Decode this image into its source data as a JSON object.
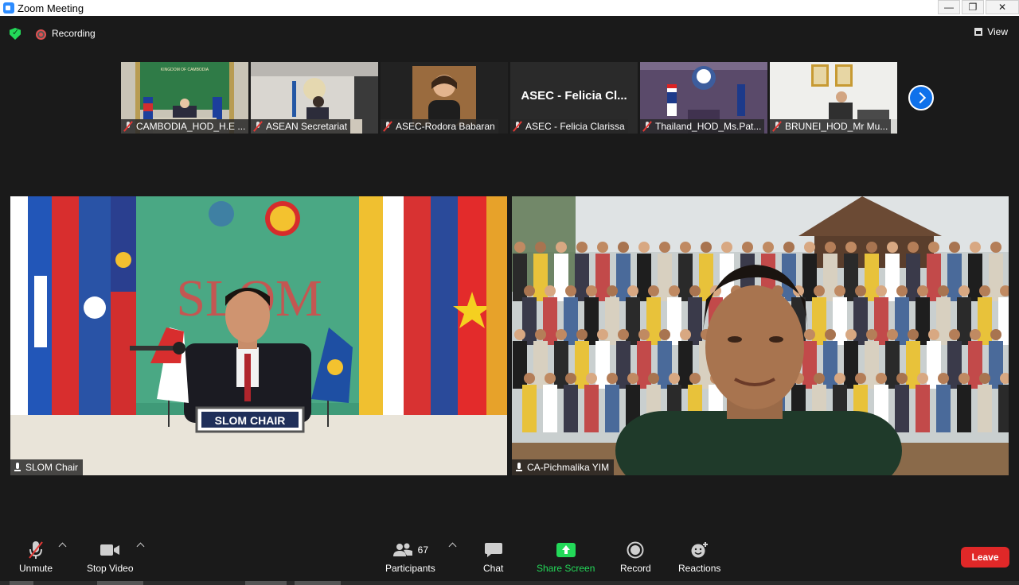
{
  "window": {
    "title": "Zoom Meeting",
    "controls": {
      "minimize": "—",
      "restore": "❐",
      "close": "✕"
    }
  },
  "top": {
    "recording_label": "Recording",
    "view_label": "View"
  },
  "thumbnails": [
    {
      "name": "CAMBODIA_HOD_H.E ...",
      "muted": true,
      "banner": "KINGDOM OF CAMBODIA"
    },
    {
      "name": "ASEAN Secretariat",
      "muted": true
    },
    {
      "name": "ASEC-Rodora Babaran",
      "muted": true
    },
    {
      "name": "ASEC - Felicia Clarissa",
      "muted": true,
      "display_text": "ASEC - Felicia Cl..."
    },
    {
      "name": "Thailand_HOD_Ms.Pat...",
      "muted": true
    },
    {
      "name": "BRUNEI_HOD_Mr Mu...",
      "muted": true
    }
  ],
  "videos": [
    {
      "name": "SLOM Chair",
      "backdrop_text": "SLOM",
      "placard": "SLOM CHAIR"
    },
    {
      "name": "CA-Pichmalika YIM"
    }
  ],
  "toolbar": {
    "unmute": "Unmute",
    "stop_video": "Stop Video",
    "participants": "Participants",
    "participants_count": "67",
    "chat": "Chat",
    "share_screen": "Share Screen",
    "record": "Record",
    "reactions": "Reactions",
    "leave": "Leave"
  },
  "colors": {
    "accent_blue": "#0e71eb",
    "share_green": "#23d959",
    "leave_red": "#e02828",
    "background": "#1a1a1a"
  }
}
